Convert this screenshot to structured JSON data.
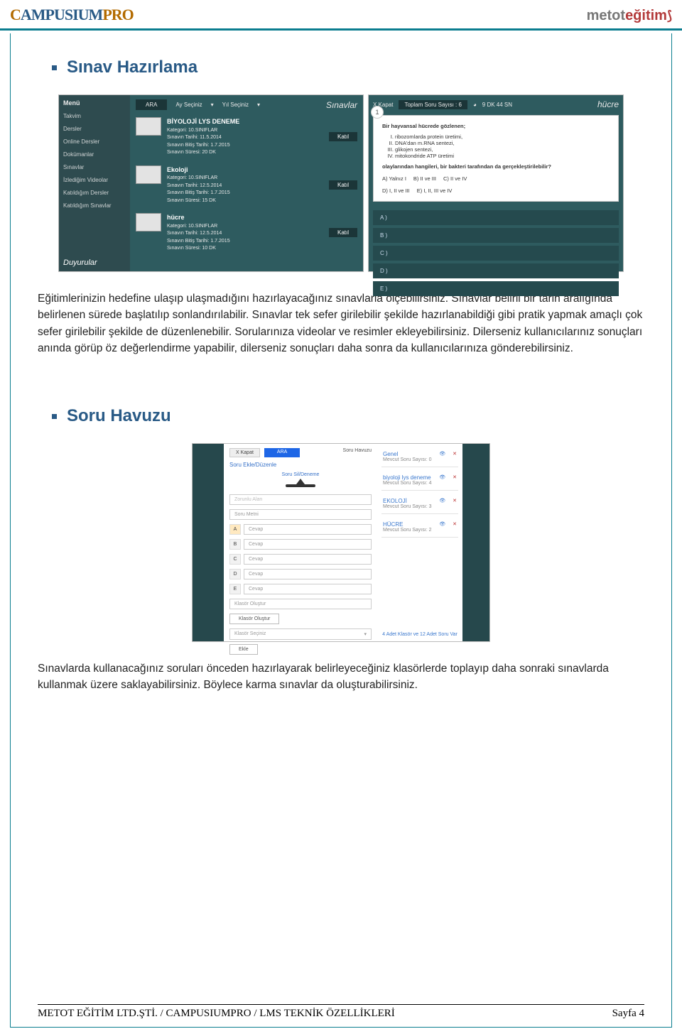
{
  "header": {
    "logo_left": "CAMPUSIUMPRO",
    "logo_right_a": "metot",
    "logo_right_b": "eğitim"
  },
  "section1": {
    "title": "Sınav Hazırlama",
    "paragraph": "Eğitimlerinizin hedefine ulaşıp ulaşmadığını hazırlayacağınız sınavlarla ölçebilirsiniz. Sınavlar belirli bir tarih aralığında belirlenen sürede başlatılıp sonlandırılabilir. Sınavlar tek sefer girilebilir şekilde hazırlanabildiği gibi pratik yapmak amaçlı çok sefer girilebilir şekilde de düzenlenebilir. Sorularınıza videolar ve resimler ekleyebilirsiniz. Dilerseniz kullanıcılarınız sonuçları anında görüp öz değerlendirme yapabilir, dilerseniz sonuçları daha sonra da kullanıcılarınıza gönderebilirsiniz."
  },
  "thumbA": {
    "menu_label": "Menü",
    "items": [
      "Takvim",
      "Dersler",
      "Online Dersler",
      "Dokümanlar",
      "Sınavlar",
      "İzlediğim Videolar",
      "Katıldığım Dersler",
      "Katıldığım Sınavlar"
    ],
    "duyurular": "Duyurular",
    "ara": "ARA",
    "ay": "Ay Seçiniz",
    "yil": "Yıl Seçiniz",
    "sinavlar": "Sınavlar",
    "katil": "Katıl",
    "cards": [
      {
        "title": "BİYOLOJİ LYS DENEME",
        "kategori": "Kategori: 10.SINIFLAR",
        "tarih": "Sınavın Tarihi: 11.5.2014",
        "bitis": "Sınavın Bitiş Tarihi: 1.7.2015",
        "sure": "Sınavın Süresi: 20 DK"
      },
      {
        "title": "Ekoloji",
        "kategori": "Kategori: 10.SINIFLAR",
        "tarih": "Sınavın Tarihi: 12.5.2014",
        "bitis": "Sınavın Bitiş Tarihi: 1.7.2015",
        "sure": "Sınavın Süresi: 15 DK"
      },
      {
        "title": "hücre",
        "kategori": "Kategori: 10.SINIFLAR",
        "tarih": "Sınavın Tarihi: 12.5.2014",
        "bitis": "Sınavın Bitiş Tarihi: 1.7.2015",
        "sure": "Sınavın Süresi: 10 DK"
      }
    ]
  },
  "thumbB": {
    "kapat": "X Kapat",
    "toplam": "Toplam Soru Sayısı : 6",
    "timer": "9 DK 44 SN",
    "hucre": "hücre",
    "qnum": "1",
    "q_intro": "Bir hayvansal hücrede gözlenen;",
    "q_items": [
      "ribozomlarda protein üretimi,",
      "DNA'dan m.RNA sentezi,",
      "glikojen sentezi,",
      "mitokondride ATP üretimi"
    ],
    "q_tail": "olaylarından hangileri, bir bakteri tarafından da gerçekleştirilebilir?",
    "choices": [
      "A) Yalnız I",
      "B) II ve III",
      "C) II ve IV",
      "D) I, II ve III",
      "E) I, II, III ve IV"
    ],
    "opts": [
      "A )",
      "B )",
      "C )",
      "D )",
      "E )"
    ]
  },
  "thumbC": {
    "kapat": "X Kapat",
    "ara": "ARA",
    "soru_havuzu": "Soru Havuzu",
    "ekle_title": "Soru Ekle/Düzenle",
    "sil": "Soru Sil/Deneme",
    "soru_metni": "Soru Metni",
    "cevap": "Cevap",
    "labs": [
      "A",
      "B",
      "C",
      "D",
      "E"
    ],
    "klasor_olustur": "Klasör Oluştur",
    "klasor_seciniz": "Klasör Seçiniz",
    "ekle": "Ekle",
    "folders": [
      {
        "name": "Genel",
        "count": "Mevcut Soru Sayısı: 0"
      },
      {
        "name": "biyoloji lys deneme",
        "count": "Mevcut Soru Sayısı: 4"
      },
      {
        "name": "EKOLOJİ",
        "count": "Mevcut Soru Sayısı: 3"
      },
      {
        "name": "HÜCRE",
        "count": "Mevcut Soru Sayısı: 2"
      }
    ],
    "summary": "4 Adet Klasör ve 12 Adet Soru Var"
  },
  "section2": {
    "title": "Soru Havuzu",
    "paragraph": "Sınavlarda kullanacağınız soruları önceden hazırlayarak belirleyeceğiniz klasörlerde toplayıp daha sonraki sınavlarda kullanmak üzere saklayabilirsiniz. Böylece karma sınavlar da oluşturabilirsiniz."
  },
  "footer": {
    "left": "METOT EĞİTİM LTD.ŞTİ. / CAMPUSIUMPRO / LMS TEKNİK ÖZELLİKLERİ",
    "right": "Sayfa 4"
  }
}
